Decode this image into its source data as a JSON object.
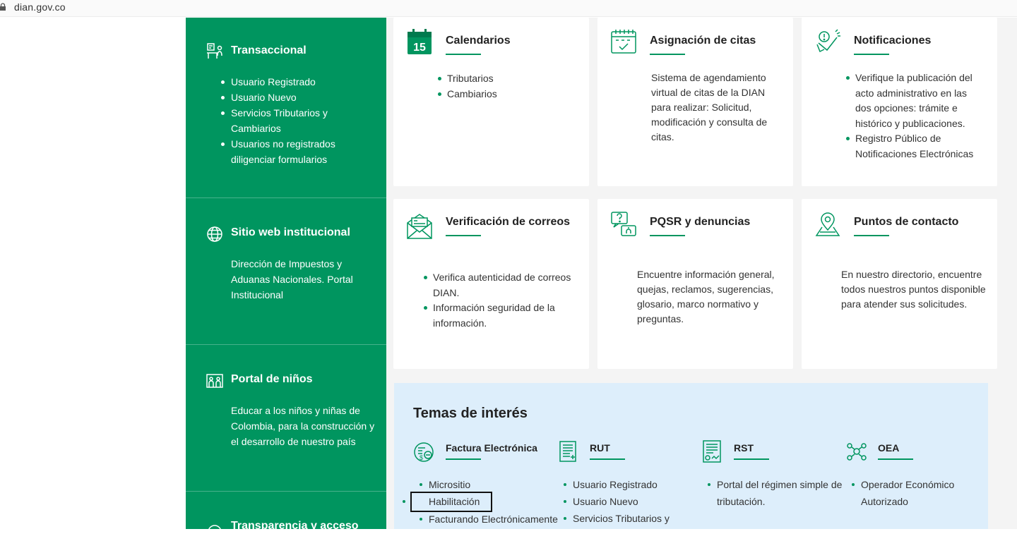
{
  "browser": {
    "url": "dian.gov.co"
  },
  "colors": {
    "brand_green": "#00955f",
    "temas_bg": "#ddeefb"
  },
  "sidebar": {
    "transaccional": {
      "title": "Transaccional",
      "icon": "desk-user-icon",
      "items": [
        "Usuario Registrado",
        "Usuario Nuevo",
        "Servicios Tributarios y",
        "Cambiarios",
        "Usuarios no registrados",
        "diligenciar formularios"
      ]
    },
    "sitio_web": {
      "title": "Sitio web institucional",
      "icon": "globe-icon",
      "lines": [
        "Dirección de Impuestos y",
        "Aduanas Nacionales. Portal",
        "Institucional"
      ]
    },
    "portal_ninos": {
      "title": "Portal de niños",
      "icon": "children-icon",
      "lines": [
        "Educar a los niños y niñas de",
        "Colombia, para la construcción y",
        "el desarrollo de nuestro país"
      ]
    },
    "transparencia": {
      "title": "Transparencia y acceso"
    }
  },
  "cards": {
    "calendarios": {
      "title": "Calendarios",
      "icon": "calendar-15-icon",
      "calendar_number": "15",
      "items": [
        "Tributarios",
        "Cambiarios"
      ]
    },
    "citas": {
      "title": "Asignación de citas",
      "icon": "calendar-check-icon",
      "lines": [
        "Sistema de agendamiento",
        "virtual de citas de la DIAN",
        "para realizar: Solicitud,",
        "modificación y consulta de",
        "citas."
      ]
    },
    "notificaciones": {
      "title": "Notificaciones",
      "icon": "megaphone-icon",
      "items": [
        [
          "Verifique la publicación del",
          "acto administrativo en las",
          "dos opciones: trámite e",
          "histórico y publicaciones."
        ],
        [
          "Registro Público de",
          "Notificaciones Electrónicas"
        ]
      ]
    },
    "correos": {
      "title": "Verificación de correos",
      "icon": "envelope-icon",
      "items": [
        [
          "Verifica autenticidad de correos",
          "DIAN."
        ],
        [
          "Información seguridad de la",
          "información."
        ]
      ]
    },
    "pqsr": {
      "title": "PQSR y denuncias",
      "icon": "question-chat-icon",
      "lines": [
        "Encuentre información general,",
        "quejas, reclamos, sugerencias,",
        "glosario, marco normativo y",
        "preguntas."
      ]
    },
    "puntos": {
      "title": "Puntos de contacto",
      "icon": "map-pin-icon",
      "lines": [
        "En nuestro directorio, encuentre",
        "todos nuestros puntos disponible",
        "para atender sus solicitudes."
      ]
    }
  },
  "temas": {
    "title": "Temas de interés",
    "factura": {
      "title": "Factura Electrónica",
      "icon": "invoice-icon",
      "items": [
        "Micrositio",
        "Habilitación",
        "Facturando Electrónicamente"
      ]
    },
    "rut": {
      "title": "RUT",
      "icon": "document-list-icon",
      "items": [
        "Usuario Registrado",
        "Usuario Nuevo",
        "Servicios Tributarios y"
      ]
    },
    "rst": {
      "title": "RST",
      "icon": "certificate-icon",
      "items": [
        "Portal del régimen simple de",
        "tributación."
      ]
    },
    "oea": {
      "title": "OEA",
      "icon": "network-people-icon",
      "items": [
        "Operador Económico",
        "Autorizado"
      ]
    }
  }
}
